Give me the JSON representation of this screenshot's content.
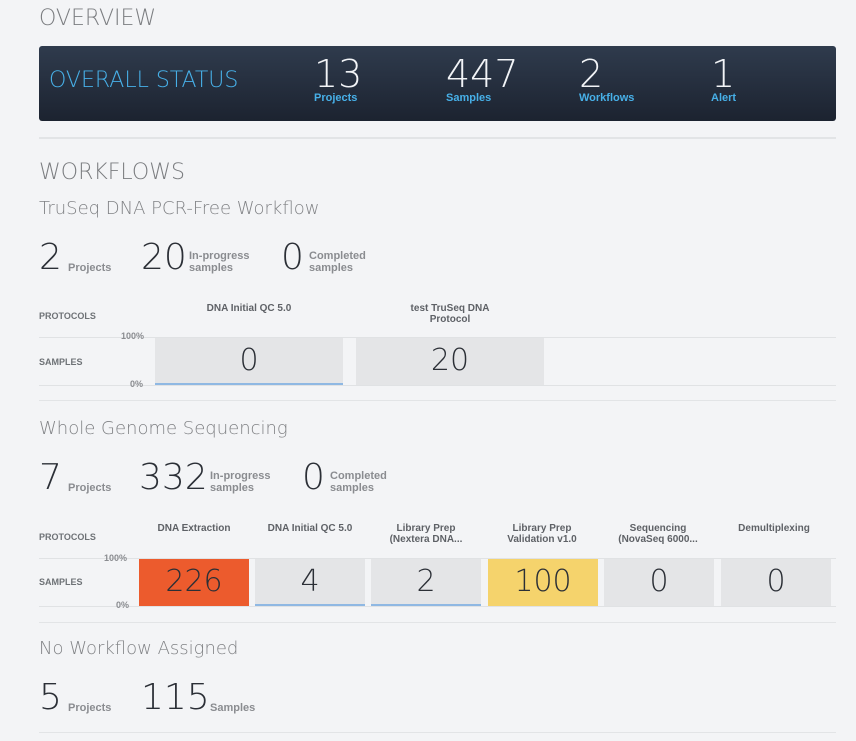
{
  "overview": {
    "title": "OVERVIEW",
    "status_title": "OVERALL STATUS",
    "stats": [
      {
        "value": "13",
        "label": "Projects"
      },
      {
        "value": "447",
        "label": "Samples"
      },
      {
        "value": "2",
        "label": "Workflows"
      },
      {
        "value": "1",
        "label": "Alert"
      }
    ]
  },
  "workflows": {
    "title": "WORKFLOWS",
    "protocols_label": "PROTOCOLS",
    "samples_label": "SAMPLES",
    "pct_top": "100%",
    "pct_bottom": "0%",
    "items": [
      {
        "name": "TruSeq DNA PCR-Free Workflow",
        "projects": "2",
        "projects_label": "Projects",
        "in_progress": "20",
        "in_progress_label_1": "In-progress",
        "in_progress_label_2": "samples",
        "completed": "0",
        "completed_label_1": "Completed",
        "completed_label_2": "samples",
        "protocols": [
          {
            "name_1": "DNA Initial QC 5.0",
            "name_2": "",
            "samples": "0",
            "status": "empty"
          },
          {
            "name_1": "test TruSeq DNA",
            "name_2": "Protocol",
            "samples": "20",
            "status": "normal"
          }
        ]
      },
      {
        "name": "Whole Genome Sequencing",
        "projects": "7",
        "projects_label": "Projects",
        "in_progress": "332",
        "in_progress_label_1": "In-progress",
        "in_progress_label_2": "samples",
        "completed": "0",
        "completed_label_1": "Completed",
        "completed_label_2": "samples",
        "protocols": [
          {
            "name_1": "DNA Extraction",
            "name_2": "",
            "samples": "226",
            "status": "alert",
            "color": "#ec5b2d"
          },
          {
            "name_1": "DNA Initial QC 5.0",
            "name_2": "",
            "samples": "4",
            "status": "low"
          },
          {
            "name_1": "Library Prep",
            "name_2": "(Nextera DNA...",
            "samples": "2",
            "status": "low"
          },
          {
            "name_1": "Library Prep",
            "name_2": "Validation v1.0",
            "samples": "100",
            "status": "warning",
            "color": "#f5d36c"
          },
          {
            "name_1": "Sequencing",
            "name_2": "(NovaSeq 6000...",
            "samples": "0",
            "status": "normal"
          },
          {
            "name_1": "Demultiplexing",
            "name_2": "",
            "samples": "0",
            "status": "normal"
          }
        ]
      }
    ]
  },
  "no_workflow": {
    "name": "No Workflow Assigned",
    "projects": "5",
    "projects_label": "Projects",
    "samples": "115",
    "samples_label": "Samples"
  }
}
